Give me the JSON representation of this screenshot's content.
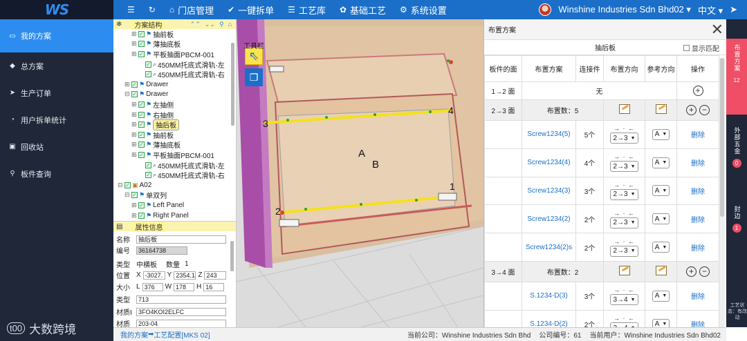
{
  "brand": {
    "logo": "WS"
  },
  "topnav": [
    {
      "label": "",
      "icon": "menu-icon",
      "glyph": "☰"
    },
    {
      "label": "",
      "icon": "refresh-icon",
      "glyph": "↻"
    },
    {
      "label": "门店管理",
      "icon": "home-icon",
      "glyph": "⌂"
    },
    {
      "label": "一键拆单",
      "icon": "check-icon",
      "glyph": "✔"
    },
    {
      "label": "工艺库",
      "icon": "list-icon",
      "glyph": "☰"
    },
    {
      "label": "基础工艺",
      "icon": "gear-icon",
      "glyph": "✿"
    },
    {
      "label": "系统设置",
      "icon": "settings-icon",
      "glyph": "⚙"
    }
  ],
  "top_right": {
    "company": "Winshine Industries Sdn Bhd02",
    "language": "中文",
    "exit_glyph": "➤"
  },
  "sidebar": [
    {
      "label": "我的方案",
      "glyph": "▭",
      "icon": "plan-icon"
    },
    {
      "label": "总方案",
      "glyph": "◆",
      "icon": "diamond-icon"
    },
    {
      "label": "生产订单",
      "glyph": "➤",
      "icon": "send-icon"
    },
    {
      "label": "用户拆单统计",
      "glyph": "◔",
      "icon": "chart-icon"
    },
    {
      "label": "回收站",
      "glyph": "▣",
      "icon": "recycle-icon"
    },
    {
      "label": "板件查询",
      "glyph": "⚲",
      "icon": "search-icon"
    }
  ],
  "watermark": {
    "icon": "t00",
    "text": "大数跨境"
  },
  "tree": {
    "title": "方案结构",
    "rows": [
      {
        "indent": 3,
        "pm": "⊞",
        "type": "flag",
        "label": "抽前板"
      },
      {
        "indent": 3,
        "pm": "⊞",
        "type": "flag",
        "label": "薄抽底板"
      },
      {
        "indent": 3,
        "pm": "⊞",
        "type": "flag",
        "label": "平板抽面PBCM-001"
      },
      {
        "indent": 4,
        "pm": "",
        "type": "clip",
        "label": "450MM托底式滑轨-左"
      },
      {
        "indent": 4,
        "pm": "",
        "type": "clip",
        "label": "450MM托底式滑轨-右"
      },
      {
        "indent": 2,
        "pm": "⊞",
        "type": "flag",
        "label": "Drawer"
      },
      {
        "indent": 2,
        "pm": "⊟",
        "type": "flag",
        "label": "Drawer"
      },
      {
        "indent": 3,
        "pm": "⊞",
        "type": "flag",
        "label": "左抽侧"
      },
      {
        "indent": 3,
        "pm": "⊞",
        "type": "flag",
        "label": "右抽侧"
      },
      {
        "indent": 3,
        "pm": "⊞",
        "type": "flag",
        "label": "抽后板",
        "selected": true
      },
      {
        "indent": 3,
        "pm": "⊞",
        "type": "flag",
        "label": "抽前板"
      },
      {
        "indent": 3,
        "pm": "⊞",
        "type": "flag",
        "label": "薄抽底板"
      },
      {
        "indent": 3,
        "pm": "⊞",
        "type": "flag",
        "label": "平板抽面PBCM-001"
      },
      {
        "indent": 4,
        "pm": "",
        "type": "clip",
        "label": "450MM托底式滑轨-左"
      },
      {
        "indent": 4,
        "pm": "",
        "type": "clip",
        "label": "450MM托底式滑轨-右"
      },
      {
        "indent": 1,
        "pm": "⊟",
        "type": "box",
        "label": "A02"
      },
      {
        "indent": 2,
        "pm": "⊟",
        "type": "flag",
        "label": "单双列"
      },
      {
        "indent": 3,
        "pm": "⊞",
        "type": "flag",
        "label": "Left Panel"
      },
      {
        "indent": 3,
        "pm": "⊞",
        "type": "flag",
        "label": "Right Panel"
      }
    ]
  },
  "attributes": {
    "title": "属性信息",
    "name_label": "名称",
    "name_value": "抽后板",
    "code_label": "编号",
    "code_value": "36164738",
    "type_label": "类型",
    "type_value": "中横板",
    "qty_label": "数量",
    "qty_value": "1",
    "pos_label": "位置",
    "pos_x_label": "X",
    "pos_x": "-3027.",
    "pos_y_label": "Y",
    "pos_y": "2354.1",
    "pos_z_label": "Z",
    "pos_z": "243",
    "size_label": "大小",
    "size_l_label": "L",
    "size_l": "376",
    "size_w_label": "W",
    "size_w": "178",
    "size_h_label": "H",
    "size_h": "16",
    "type2_label": "类型",
    "type2_value": "713",
    "mat_id_label": "材质I",
    "mat_id_value": "3FO4KOI2ELFC",
    "mat_label": "材质",
    "mat_value": "203-04"
  },
  "viewport": {
    "tool_label": "工具栏",
    "labels": {
      "a": "A",
      "b": "B",
      "n1": "1",
      "n2": "2",
      "n3": "3",
      "n4": "4"
    }
  },
  "dialog": {
    "title": "布置方案",
    "subtitle": "抽后板",
    "show_match": "显示匹配",
    "headers": [
      "板件的面",
      "布置方案",
      "连接件",
      "布置方向",
      "参考方向",
      "操作"
    ],
    "empty_face": "1→2 面",
    "empty_text": "无",
    "groups": [
      {
        "face": "2→3 面",
        "count_text": "布置数：5",
        "items": [
          {
            "name": "Screw1234(5)",
            "qty": "5个",
            "dir": "2→3",
            "ref": "A",
            "op": "删除"
          },
          {
            "name": "Screw1234(4)",
            "qty": "4个",
            "dir": "2→3",
            "ref": "A",
            "op": "删除"
          },
          {
            "name": "Screw1234(3)",
            "qty": "3个",
            "dir": "2→3",
            "ref": "A",
            "op": "删除"
          },
          {
            "name": "Screw1234(2)",
            "qty": "2个",
            "dir": "2→3",
            "ref": "A",
            "op": "删除"
          },
          {
            "name": "Screw1234(2)s",
            "qty": "2个",
            "dir": "2→3",
            "ref": "A",
            "op": "删除"
          }
        ]
      },
      {
        "face": "3→4 面",
        "count_text": "布置数：2",
        "items": [
          {
            "name": "S.1234-D(3)",
            "qty": "3个",
            "dir": "3→4",
            "ref": "A",
            "op": "删除"
          },
          {
            "name": "S.1234-D(2)",
            "qty": "2个",
            "dir": "3→4",
            "ref": "A",
            "op": "删除"
          }
        ]
      }
    ]
  },
  "right_tabs": [
    {
      "label": "布置方案",
      "count": "12"
    },
    {
      "label": "外部五金",
      "count": "0"
    },
    {
      "label": "封边",
      "count": "1"
    }
  ],
  "right_note": "工艺状态：有改动",
  "status": {
    "crumb_home": "我的方案",
    "crumb_arrow": "➡",
    "crumb_current": "工艺配置[MKS 02]",
    "company": "当前公司：Winshine Industries Sdn Bhd",
    "company_no": "公司编号：61",
    "user": "当前用户：Winshine Industries Sdn Bhd02"
  },
  "colors": {
    "topbar": "#1b6fc9",
    "sidebar": "#1f2739",
    "accent": "#2d8cf0",
    "tab_active": "#ef4e66"
  }
}
